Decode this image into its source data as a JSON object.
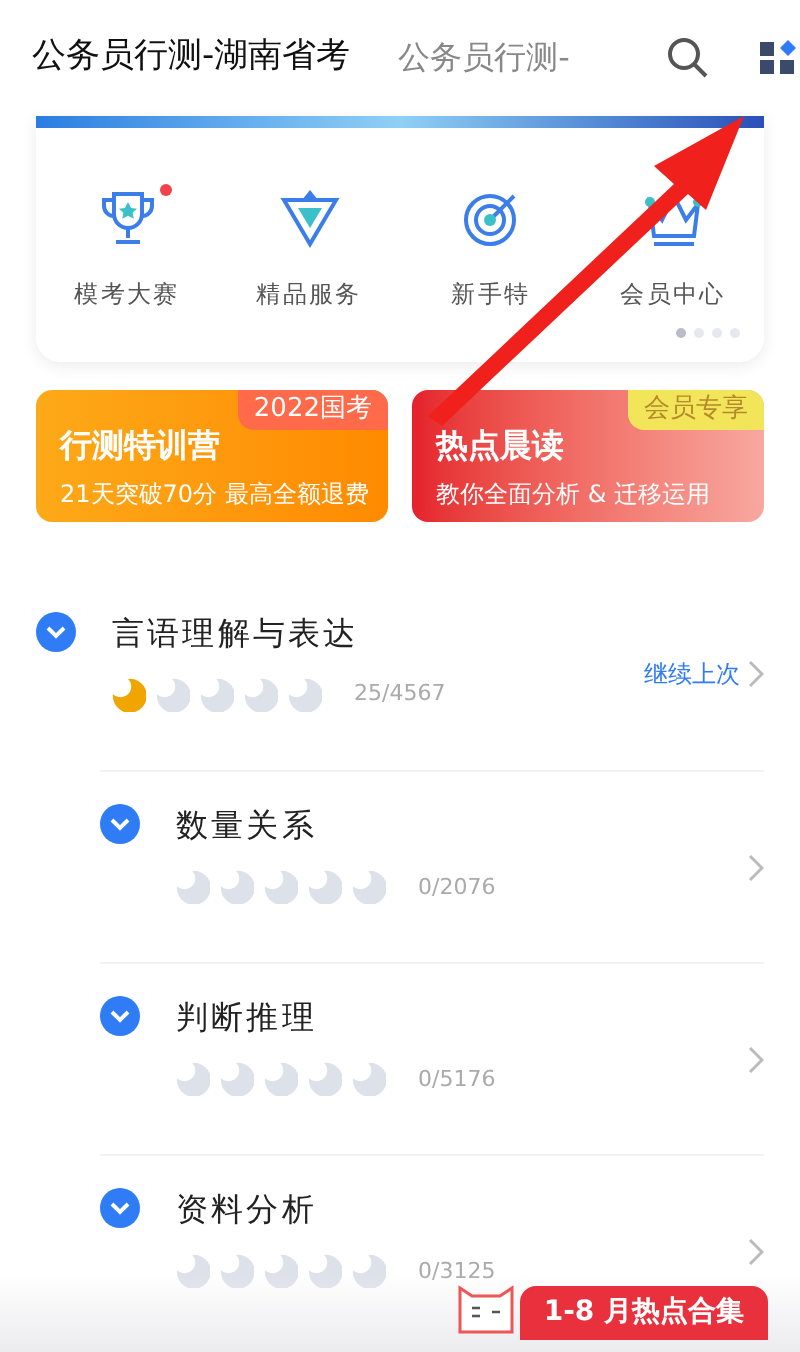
{
  "tabs": [
    {
      "label": "公务员行测-湖南省考",
      "selected": true
    },
    {
      "label": "公务员行测-",
      "selected": false
    }
  ],
  "shortcuts": [
    {
      "label": "模考大赛",
      "kind": "trophy",
      "dot": true
    },
    {
      "label": "精品服务",
      "kind": "badge",
      "dot": false
    },
    {
      "label": "新手特",
      "kind": "target",
      "dot": false
    },
    {
      "label": "会员中心",
      "kind": "crown",
      "dot": false
    }
  ],
  "pager": [
    {
      "selected": true
    },
    {
      "selected": false
    },
    {
      "selected": false
    },
    {
      "selected": false
    }
  ],
  "promos": [
    {
      "kind": "orange",
      "title": "行测特训营",
      "tag": "2022国考",
      "subtitle": "21天突破70分 最高全额退费"
    },
    {
      "kind": "red",
      "title": "热点晨读",
      "tag": "会员专享",
      "subtitle": "教你全面分析 & 迁移运用"
    }
  ],
  "subjects": [
    {
      "name": "言语理解与表达",
      "stars": 1,
      "count": "25/4567",
      "action": "继续上次"
    },
    {
      "name": "数量关系",
      "stars": 0,
      "count": "0/2076"
    },
    {
      "name": "判断推理",
      "stars": 0,
      "count": "0/5176"
    },
    {
      "name": "资料分析",
      "stars": 0,
      "count": "0/3125"
    }
  ],
  "float_badge": {
    "label": "1-8 月热点合集"
  }
}
